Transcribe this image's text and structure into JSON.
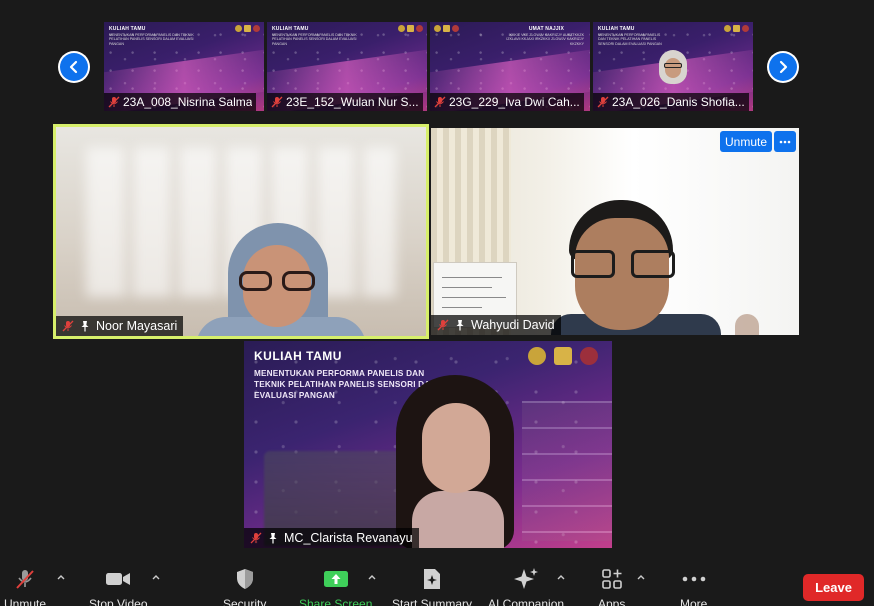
{
  "strip": {
    "thumbnails": [
      {
        "name": "23A_008_Nisrina Salma",
        "slide_title": "KULIAH TAMU",
        "slide_subtitle": "MENENTUKAN PERFORMA PANELIS DAN TEKNIK PELATIHAN PANELIS SENSORI DALAM EVALUASI PANGAN"
      },
      {
        "name": "23E_152_Wulan Nur S...",
        "slide_title": "KULIAH TAMU",
        "slide_subtitle": "MENENTUKAN PERFORMA PANELIS DAN TEKNIK PELATIHAN PANELIS SENSORI DALAM EVALUASI PANGAN"
      },
      {
        "name": "23G_229_Iva Dwi Cah...",
        "slide_title": "UMAT NAJJIX",
        "slide_subtitle": "IKKKIE VKE ZLGWJV KAKRIZJY AUKZTKKZK IZKLAVII KKJAXI IRKZKKX ZLGWJV KAKRIZJY KKZKKY"
      },
      {
        "name": "23A_026_Danis Shofia...",
        "slide_title": "KULIAH TAMU",
        "slide_subtitle": "MENENTUKAN PERFORMA PANELIS DAN TEKNIK PELATIHAN PANELIS SENSORI DALAM EVALUASI PANGAN"
      }
    ]
  },
  "tiles": {
    "noor": {
      "name": "Noor Mayasari"
    },
    "wahyudi": {
      "name": "Wahyudi David",
      "unmute_label": "Unmute"
    },
    "mc": {
      "name": "MC_Clarista Revanayu",
      "slide_title": "KULIAH TAMU",
      "slide_subtitle": "MENENTUKAN PERFORMA PANELIS DAN TEKNIK PELATIHAN PANELIS SENSORI DALAM EVALUASI PANGAN"
    }
  },
  "toolbar": {
    "unmute": "Unmute",
    "stop_video": "Stop Video",
    "security": "Security",
    "share_screen": "Share Screen",
    "start_summary": "Start Summary",
    "ai_companion": "AI Companion",
    "apps": "Apps",
    "more": "More",
    "leave": "Leave"
  },
  "colors": {
    "accent": "#0e72ed",
    "active_speaker": "#d7ef6b",
    "share": "#3fcf5a",
    "leave": "#e02828",
    "muted": "#e0403c"
  }
}
